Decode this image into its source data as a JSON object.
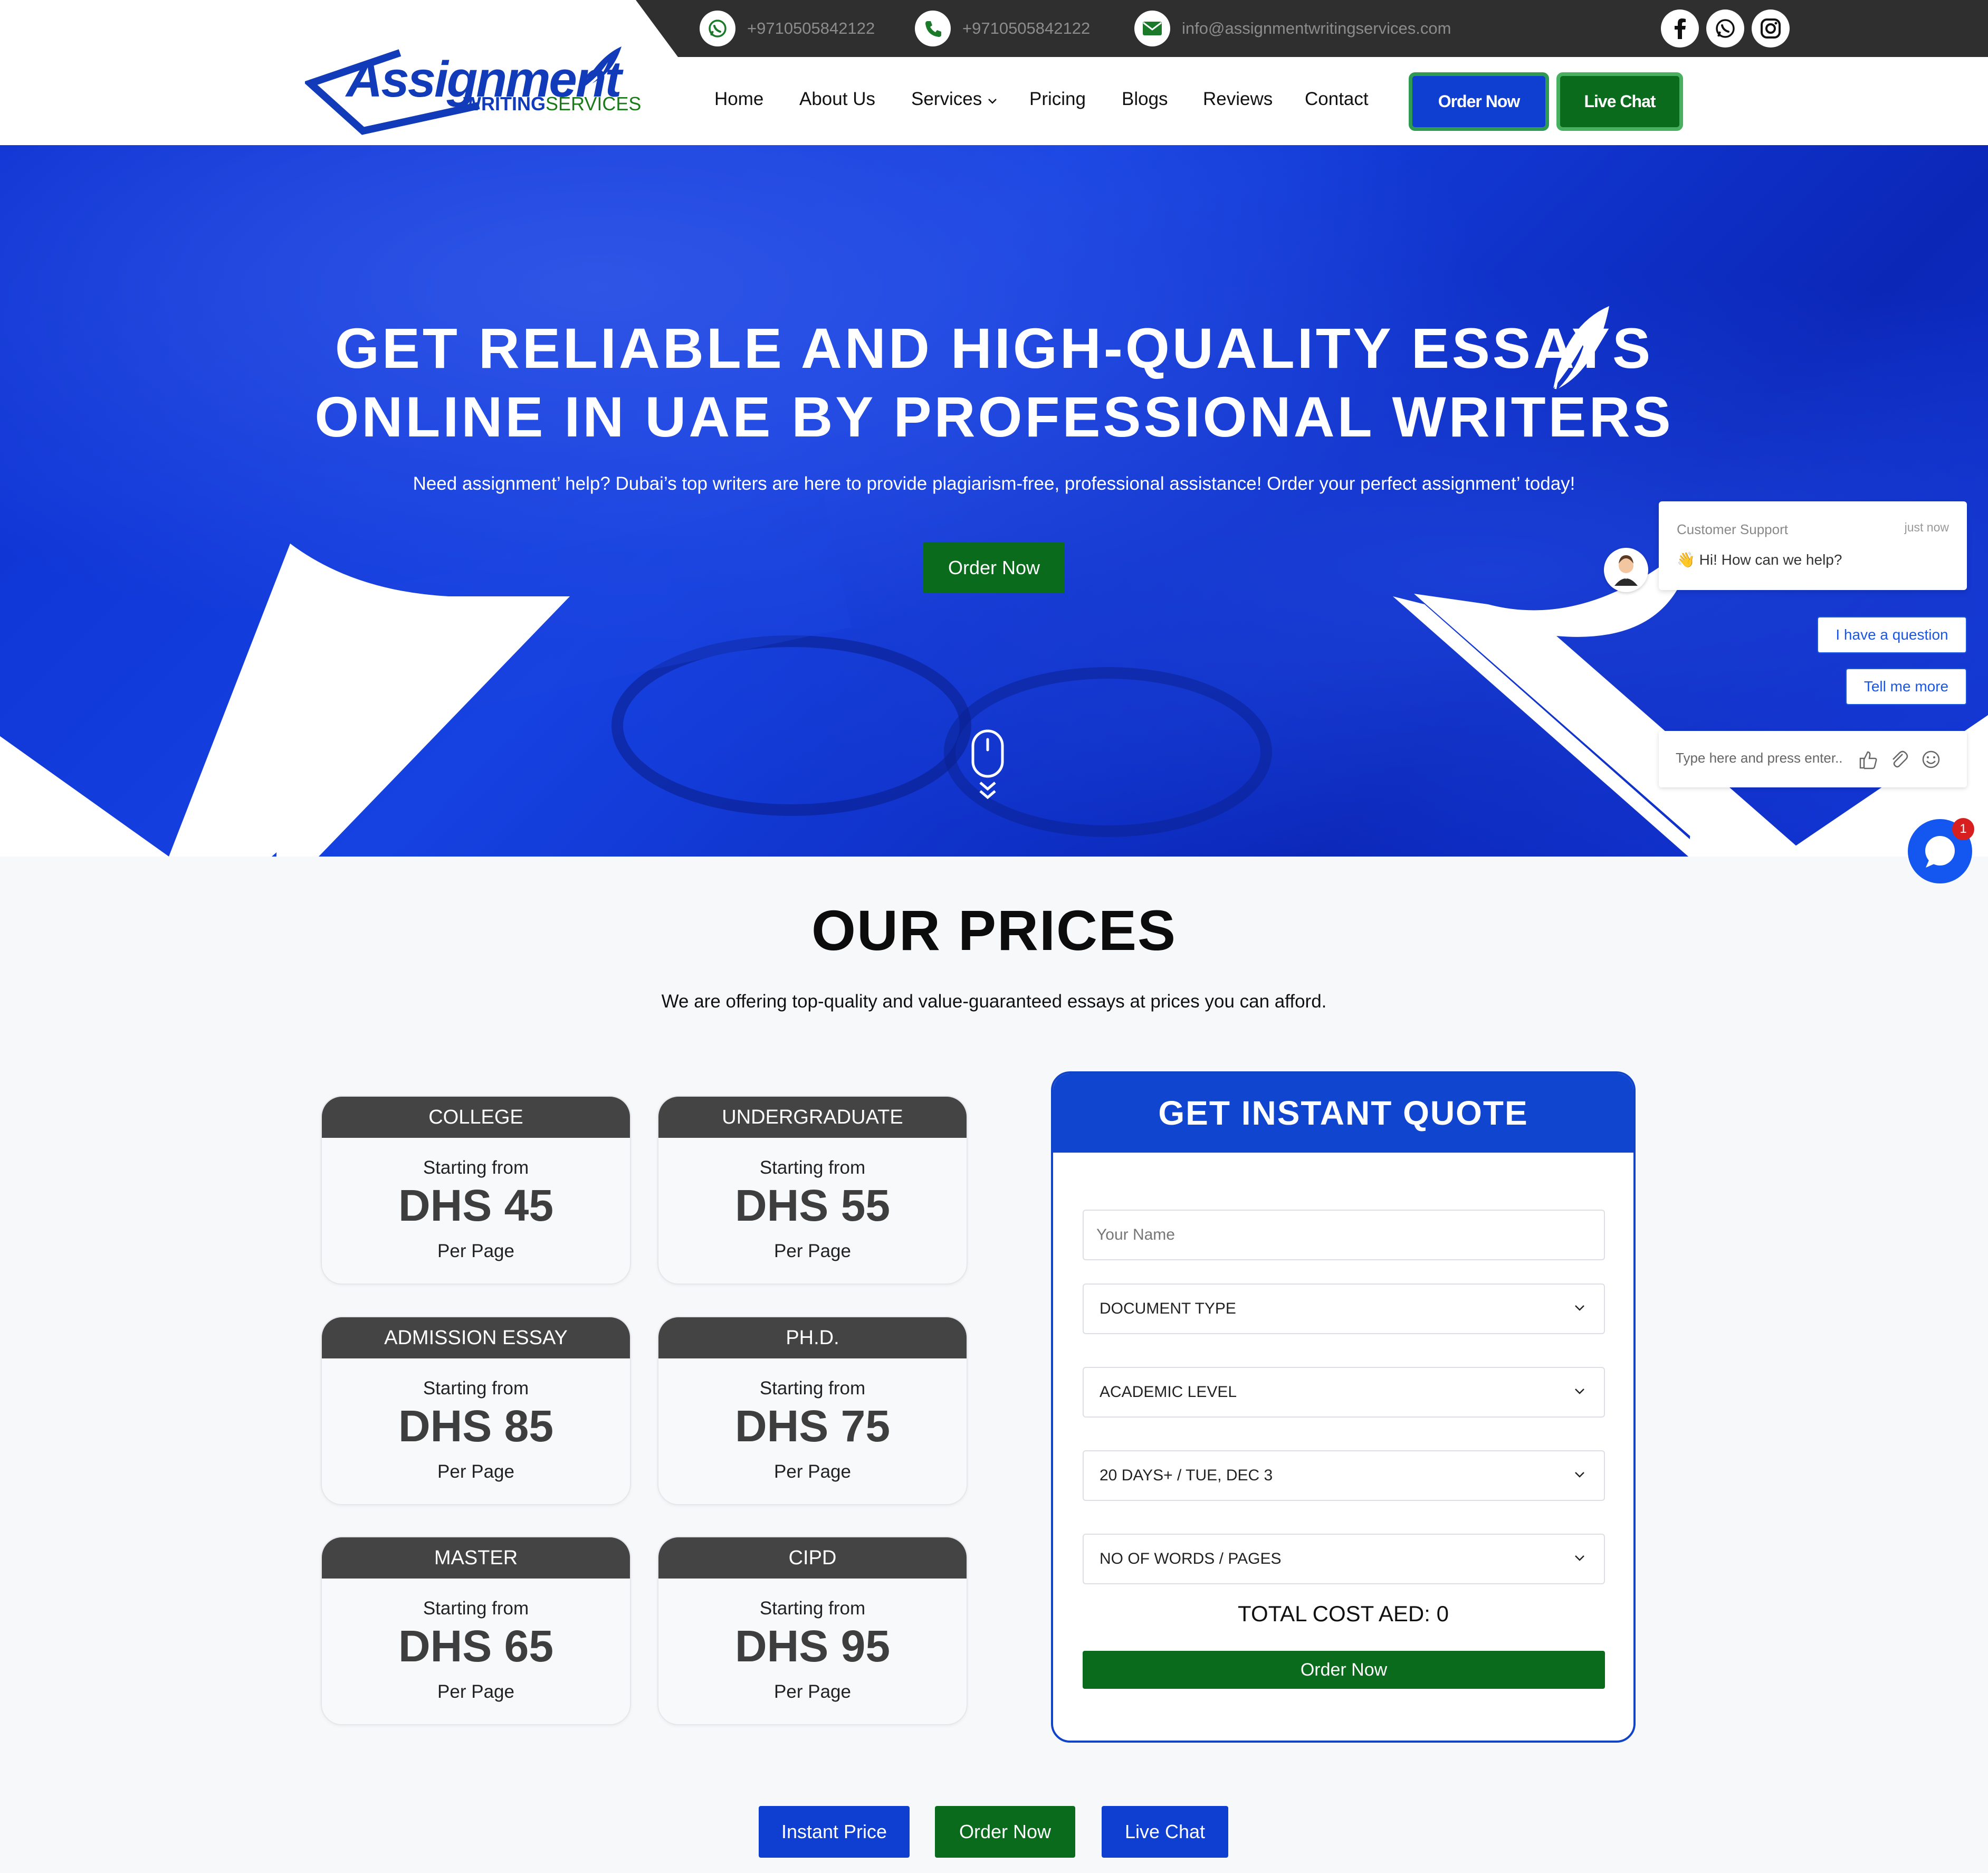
{
  "contacts": {
    "whatsapp": "+9710505842122",
    "phone": "+9710505842122",
    "email": "info@assignmentwritingservices.com"
  },
  "social": [
    "facebook-icon",
    "whatsapp-icon",
    "instagram-icon"
  ],
  "logo": {
    "word": "Assignment",
    "sub_bold": "WRITING",
    "sub_rest": "SERVICES"
  },
  "nav": [
    "Home",
    "About Us",
    "Services",
    "Pricing",
    "Blogs",
    "Reviews",
    "Contact"
  ],
  "header_buttons": {
    "order": "Order Now",
    "chat": "Live Chat"
  },
  "hero": {
    "title_line1": "GET RELIABLE AND HIGH-QUALITY ESSAYS",
    "title_line2": "ONLINE IN UAE BY PROFESSIONAL WRITERS",
    "subtitle": "Need assignment’ help? Dubai’s top writers are here to provide plagiarism-free, professional assistance! Order your perfect assignment’ today!",
    "button": "Order Now"
  },
  "chat": {
    "label": "Customer Support",
    "time": "just now",
    "message": "👋 Hi! How can we help?",
    "chips": [
      "I have a question",
      "Tell me more"
    ],
    "placeholder": "Type here and press enter..",
    "badge": "1"
  },
  "prices": {
    "title": "OUR PRICES",
    "subtitle": "We are offering top-quality and value-guaranteed essays at prices you can afford.",
    "cards": [
      {
        "level": "COLLEGE",
        "from": "Starting from",
        "price": "DHS 45",
        "per": "Per Page"
      },
      {
        "level": "UNDERGRADUATE",
        "from": "Starting from",
        "price": "DHS 55",
        "per": "Per Page"
      },
      {
        "level": "ADMISSION ESSAY",
        "from": "Starting from",
        "price": "DHS 85",
        "per": "Per Page"
      },
      {
        "level": "PH.D.",
        "from": "Starting from",
        "price": "DHS 75",
        "per": "Per Page"
      },
      {
        "level": "MASTER",
        "from": "Starting from",
        "price": "DHS 65",
        "per": "Per Page"
      },
      {
        "level": "CIPD",
        "from": "Starting from",
        "price": "DHS 95",
        "per": "Per Page"
      }
    ]
  },
  "quote": {
    "title": "GET INSTANT QUOTE",
    "name_placeholder": "Your Name",
    "document_type": "DOCUMENT TYPE",
    "academic_level": "ACADEMIC LEVEL",
    "deadline": "20 DAYS+ / TUE, DEC 3",
    "words": "NO OF WORDS / PAGES",
    "total": "TOTAL COST AED: 0",
    "button": "Order Now"
  },
  "bottom_buttons": [
    "Instant Price",
    "Order Now",
    "Live Chat"
  ],
  "colors": {
    "brand_blue": "#0f45cf",
    "brand_green": "#0b6b1c",
    "dark": "#2f2f2f"
  }
}
